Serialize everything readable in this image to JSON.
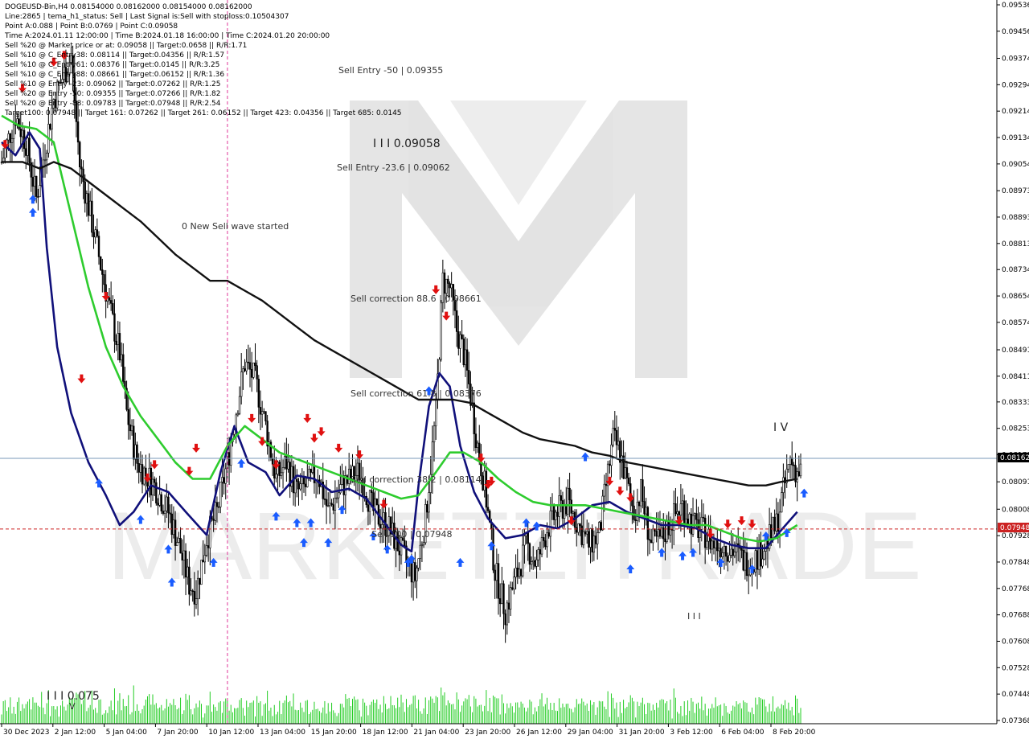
{
  "window": {
    "symbol_line": "DOGEUSD-Bin,H4  0.08154000 0.08162000 0.08154000 0.08162000"
  },
  "info_lines": [
    "Line:2865  | tema_h1_status: Sell | Last Signal is:Sell with stoploss:0.10504307",
    "Point A:0.088 | Point B:0.0769 | Point C:0.09058",
    "Time A:2024.01.11 12:00:00 | Time B:2024.01.18 16:00:00 | Time C:2024.01.20 20:00:00",
    "Sell %20 @ Market price or at: 0.09058 || Target:0.0658 || R/R:1.71",
    "Sell %10 @ C_Entry38: 0.08114 || Target:0.04356 || R/R:1.57",
    "Sell %10 @ C_Entry61: 0.08376 || Target:0.0145 || R/R:3.25",
    "Sell %10 @ C_Entry88: 0.08661 || Target:0.06152 || R/R:1.36",
    "Sell %10 @ Entry -23: 0.09062 || Target:0.07262 || R/R:1.25",
    "Sell %20 @ Entry -50: 0.09355 || Target:0.07266 || R/R:1.82",
    "Sell %20 @ Entry -88: 0.09783 || Target:0.07948 || R/R:2.54",
    "Target100: 0.07948 || Target 161: 0.07262 || Target 261: 0.06152 || Target 423: 0.04356 || Target 685: 0.0145"
  ],
  "annotations": {
    "sell_entry_50": "Sell Entry -50 | 0.09355",
    "point_c": "I I I 0.09058",
    "sell_entry_236": "Sell Entry -23.6 | 0.09062",
    "new_sell_wave": "0 New Sell wave started",
    "sell_corr_886": "Sell correction 88.6 | 0.08661",
    "sell_corr_618": "Sell correction 61.8 | 0.08376",
    "sell_corr_382": "Sell correction 38.2 | 0.08114",
    "sell_100": "Sell 100 | 0.07948",
    "point_b": "I I I 0.075",
    "wave_iv": "I V",
    "wave_iii_small": "I I I",
    "wave_v_low": "V"
  },
  "price_labels": {
    "current": "0.08162",
    "target": "0.07948"
  },
  "colors": {
    "ema_fast": "#10107a",
    "ema_mid": "#2ecc2e",
    "ema_slow": "#111111",
    "up_arrow": "#1a5cff",
    "down_arrow": "#e01010",
    "volume": "#22cc22",
    "current_line": "#7a9ab8",
    "target_line": "#cc2222",
    "time_marker": "#e0389a"
  },
  "chart_data": {
    "type": "candlestick",
    "y_ticks": [
      "0.09536",
      "0.09456",
      "0.09374",
      "0.09294",
      "0.09214",
      "0.09134",
      "0.09054",
      "0.08973",
      "0.08893",
      "0.08813",
      "0.08734",
      "0.08654",
      "0.08574",
      "0.08491",
      "0.08411",
      "0.08333",
      "0.08253",
      "0.08173",
      "0.08091",
      "0.08008",
      "0.07928",
      "0.07848",
      "0.07768",
      "0.07688",
      "0.07608",
      "0.07528",
      "0.07448",
      "0.07368"
    ],
    "ylim": [
      0.07368,
      0.09536
    ],
    "x_ticks": [
      "30 Dec 2023",
      "2 Jan 12:00",
      "5 Jan 04:00",
      "7 Jan 20:00",
      "10 Jan 12:00",
      "13 Jan 04:00",
      "15 Jan 20:00",
      "18 Jan 12:00",
      "21 Jan 04:00",
      "23 Jan 20:00",
      "26 Jan 12:00",
      "29 Jan 04:00",
      "31 Jan 20:00",
      "3 Feb 12:00",
      "6 Feb 04:00",
      "8 Feb 20:00"
    ],
    "price_path": [
      [
        0,
        0.0906
      ],
      [
        8,
        0.092
      ],
      [
        14,
        0.0912
      ],
      [
        20,
        0.0895
      ],
      [
        30,
        0.0925
      ],
      [
        40,
        0.0938
      ],
      [
        45,
        0.0905
      ],
      [
        55,
        0.088
      ],
      [
        62,
        0.0862
      ],
      [
        68,
        0.0848
      ],
      [
        72,
        0.083
      ],
      [
        78,
        0.0815
      ],
      [
        88,
        0.0808
      ],
      [
        96,
        0.08
      ],
      [
        102,
        0.079
      ],
      [
        108,
        0.0778
      ],
      [
        112,
        0.0776
      ],
      [
        118,
        0.0792
      ],
      [
        124,
        0.08
      ],
      [
        130,
        0.0815
      ],
      [
        134,
        0.0828
      ],
      [
        140,
        0.0845
      ],
      [
        146,
        0.084
      ],
      [
        152,
        0.0826
      ],
      [
        158,
        0.081
      ],
      [
        164,
        0.0815
      ],
      [
        170,
        0.0806
      ],
      [
        176,
        0.0808
      ],
      [
        182,
        0.0812
      ],
      [
        188,
        0.08
      ],
      [
        196,
        0.0808
      ],
      [
        206,
        0.0812
      ],
      [
        214,
        0.08
      ],
      [
        222,
        0.0796
      ],
      [
        230,
        0.0788
      ],
      [
        238,
        0.078
      ],
      [
        244,
        0.0798
      ],
      [
        250,
        0.083
      ],
      [
        254,
        0.087
      ],
      [
        258,
        0.0868
      ],
      [
        262,
        0.0855
      ],
      [
        266,
        0.0848
      ],
      [
        270,
        0.0835
      ],
      [
        274,
        0.082
      ],
      [
        278,
        0.0808
      ],
      [
        284,
        0.0782
      ],
      [
        290,
        0.077
      ],
      [
        296,
        0.078
      ],
      [
        302,
        0.079
      ],
      [
        308,
        0.0784
      ],
      [
        314,
        0.0795
      ],
      [
        320,
        0.08
      ],
      [
        326,
        0.0803
      ],
      [
        332,
        0.0796
      ],
      [
        338,
        0.079
      ],
      [
        344,
        0.0793
      ],
      [
        348,
        0.0808
      ],
      [
        352,
        0.0822
      ],
      [
        356,
        0.0818
      ],
      [
        360,
        0.0808
      ],
      [
        364,
        0.08
      ],
      [
        368,
        0.0806
      ],
      [
        374,
        0.079
      ],
      [
        380,
        0.0792
      ],
      [
        386,
        0.0798
      ],
      [
        392,
        0.0802
      ],
      [
        398,
        0.0796
      ],
      [
        404,
        0.0794
      ],
      [
        410,
        0.079
      ],
      [
        416,
        0.079
      ],
      [
        422,
        0.0788
      ],
      [
        428,
        0.0785
      ],
      [
        434,
        0.0786
      ],
      [
        440,
        0.079
      ],
      [
        446,
        0.0796
      ],
      [
        450,
        0.0806
      ],
      [
        454,
        0.0816
      ],
      [
        458,
        0.0812
      ]
    ],
    "series": [
      {
        "name": "",
        "color": "#10107a",
        "values": [
          [
            0,
            0.0912
          ],
          [
            8,
            0.0908
          ],
          [
            16,
            0.0915
          ],
          [
            22,
            0.091
          ],
          [
            26,
            0.088
          ],
          [
            32,
            0.085
          ],
          [
            40,
            0.083
          ],
          [
            50,
            0.0815
          ],
          [
            60,
            0.0805
          ],
          [
            68,
            0.0796
          ],
          [
            76,
            0.08
          ],
          [
            86,
            0.0808
          ],
          [
            96,
            0.0806
          ],
          [
            106,
            0.08
          ],
          [
            118,
            0.0793
          ],
          [
            126,
            0.0812
          ],
          [
            134,
            0.0826
          ],
          [
            142,
            0.0815
          ],
          [
            152,
            0.0812
          ],
          [
            160,
            0.0805
          ],
          [
            170,
            0.0811
          ],
          [
            180,
            0.081
          ],
          [
            190,
            0.0806
          ],
          [
            200,
            0.0807
          ],
          [
            210,
            0.0804
          ],
          [
            220,
            0.0797
          ],
          [
            230,
            0.079
          ],
          [
            236,
            0.0788
          ],
          [
            240,
            0.0808
          ],
          [
            246,
            0.0832
          ],
          [
            252,
            0.0842
          ],
          [
            258,
            0.0838
          ],
          [
            264,
            0.082
          ],
          [
            272,
            0.0806
          ],
          [
            280,
            0.0798
          ],
          [
            290,
            0.0792
          ],
          [
            300,
            0.0793
          ],
          [
            310,
            0.0796
          ],
          [
            320,
            0.0795
          ],
          [
            330,
            0.0798
          ],
          [
            340,
            0.0802
          ],
          [
            350,
            0.0803
          ],
          [
            360,
            0.08
          ],
          [
            370,
            0.0798
          ],
          [
            380,
            0.0796
          ],
          [
            390,
            0.0796
          ],
          [
            400,
            0.0795
          ],
          [
            410,
            0.0792
          ],
          [
            420,
            0.079
          ],
          [
            430,
            0.0789
          ],
          [
            440,
            0.0789
          ],
          [
            448,
            0.0794
          ],
          [
            458,
            0.08
          ]
        ]
      },
      {
        "name": "",
        "color": "#2ecc2e",
        "values": [
          [
            0,
            0.092
          ],
          [
            10,
            0.0917
          ],
          [
            20,
            0.0916
          ],
          [
            30,
            0.0912
          ],
          [
            40,
            0.089
          ],
          [
            50,
            0.0868
          ],
          [
            60,
            0.085
          ],
          [
            70,
            0.0838
          ],
          [
            80,
            0.0829
          ],
          [
            90,
            0.0822
          ],
          [
            100,
            0.0815
          ],
          [
            110,
            0.081
          ],
          [
            120,
            0.081
          ],
          [
            130,
            0.082
          ],
          [
            140,
            0.0826
          ],
          [
            150,
            0.0822
          ],
          [
            160,
            0.0818
          ],
          [
            170,
            0.0816
          ],
          [
            180,
            0.0814
          ],
          [
            190,
            0.0812
          ],
          [
            200,
            0.081
          ],
          [
            210,
            0.0808
          ],
          [
            220,
            0.0806
          ],
          [
            230,
            0.0804
          ],
          [
            240,
            0.0805
          ],
          [
            250,
            0.0812
          ],
          [
            258,
            0.0818
          ],
          [
            266,
            0.0818
          ],
          [
            276,
            0.0815
          ],
          [
            286,
            0.081
          ],
          [
            296,
            0.0806
          ],
          [
            306,
            0.0803
          ],
          [
            316,
            0.0802
          ],
          [
            326,
            0.0802
          ],
          [
            336,
            0.0802
          ],
          [
            346,
            0.0801
          ],
          [
            356,
            0.08
          ],
          [
            366,
            0.0799
          ],
          [
            376,
            0.0798
          ],
          [
            386,
            0.0797
          ],
          [
            396,
            0.0796
          ],
          [
            406,
            0.0796
          ],
          [
            416,
            0.0794
          ],
          [
            426,
            0.0792
          ],
          [
            436,
            0.0791
          ],
          [
            446,
            0.0792
          ],
          [
            458,
            0.0796
          ]
        ]
      },
      {
        "name": "",
        "color": "#111111",
        "values": [
          [
            0,
            0.0906
          ],
          [
            12,
            0.0906
          ],
          [
            22,
            0.0904
          ],
          [
            30,
            0.0906
          ],
          [
            40,
            0.0904
          ],
          [
            50,
            0.09
          ],
          [
            60,
            0.0896
          ],
          [
            70,
            0.0892
          ],
          [
            80,
            0.0888
          ],
          [
            90,
            0.0883
          ],
          [
            100,
            0.0878
          ],
          [
            110,
            0.0874
          ],
          [
            120,
            0.087
          ],
          [
            130,
            0.087
          ],
          [
            140,
            0.0867
          ],
          [
            150,
            0.0864
          ],
          [
            160,
            0.086
          ],
          [
            170,
            0.0856
          ],
          [
            180,
            0.0852
          ],
          [
            190,
            0.0849
          ],
          [
            200,
            0.0846
          ],
          [
            210,
            0.0843
          ],
          [
            220,
            0.084
          ],
          [
            230,
            0.0837
          ],
          [
            240,
            0.0834
          ],
          [
            250,
            0.0834
          ],
          [
            260,
            0.0834
          ],
          [
            270,
            0.0833
          ],
          [
            280,
            0.083
          ],
          [
            290,
            0.0827
          ],
          [
            300,
            0.0824
          ],
          [
            310,
            0.0822
          ],
          [
            320,
            0.0821
          ],
          [
            330,
            0.082
          ],
          [
            340,
            0.0818
          ],
          [
            350,
            0.0817
          ],
          [
            360,
            0.0815
          ],
          [
            370,
            0.0814
          ],
          [
            380,
            0.0813
          ],
          [
            390,
            0.0812
          ],
          [
            400,
            0.0811
          ],
          [
            410,
            0.081
          ],
          [
            420,
            0.0809
          ],
          [
            430,
            0.0808
          ],
          [
            440,
            0.0808
          ],
          [
            448,
            0.0809
          ],
          [
            458,
            0.081
          ]
        ]
      }
    ],
    "x_index_max": 460,
    "current_price": 0.08162,
    "target_level": 0.07948,
    "time_marker_index": 130,
    "up_arrows": [
      [
        18,
        0.0898
      ],
      [
        18,
        0.0894
      ],
      [
        56,
        0.0812
      ],
      [
        80,
        0.0801
      ],
      [
        96,
        0.0792
      ],
      [
        98,
        0.0782
      ],
      [
        122,
        0.0788
      ],
      [
        138,
        0.0818
      ],
      [
        158,
        0.0802
      ],
      [
        170,
        0.08
      ],
      [
        174,
        0.0794
      ],
      [
        178,
        0.08
      ],
      [
        188,
        0.0794
      ],
      [
        196,
        0.0804
      ],
      [
        214,
        0.0796
      ],
      [
        222,
        0.0792
      ],
      [
        234,
        0.0788
      ],
      [
        236,
        0.0789
      ],
      [
        246,
        0.084
      ],
      [
        264,
        0.0788
      ],
      [
        282,
        0.0793
      ],
      [
        302,
        0.08
      ],
      [
        308,
        0.0799
      ],
      [
        336,
        0.082
      ],
      [
        362,
        0.0786
      ],
      [
        380,
        0.0791
      ],
      [
        392,
        0.079
      ],
      [
        398,
        0.0791
      ],
      [
        414,
        0.0788
      ],
      [
        432,
        0.0786
      ],
      [
        440,
        0.0796
      ],
      [
        452,
        0.0797
      ],
      [
        462,
        0.0809
      ]
    ],
    "down_arrows": [
      [
        2,
        0.0908
      ],
      [
        12,
        0.0925
      ],
      [
        30,
        0.0933
      ],
      [
        36,
        0.0935
      ],
      [
        60,
        0.0862
      ],
      [
        46,
        0.0837
      ],
      [
        84,
        0.0807
      ],
      [
        88,
        0.0811
      ],
      [
        108,
        0.0809
      ],
      [
        112,
        0.0816
      ],
      [
        144,
        0.0825
      ],
      [
        150,
        0.0818
      ],
      [
        158,
        0.0811
      ],
      [
        176,
        0.0825
      ],
      [
        180,
        0.0819
      ],
      [
        184,
        0.0821
      ],
      [
        194,
        0.0816
      ],
      [
        206,
        0.0814
      ],
      [
        220,
        0.0799
      ],
      [
        250,
        0.0864
      ],
      [
        256,
        0.0856
      ],
      [
        276,
        0.0813
      ],
      [
        280,
        0.0805
      ],
      [
        282,
        0.0806
      ],
      [
        328,
        0.0794
      ],
      [
        350,
        0.0806
      ],
      [
        356,
        0.0803
      ],
      [
        362,
        0.0801
      ],
      [
        390,
        0.0794
      ],
      [
        408,
        0.079
      ],
      [
        418,
        0.0793
      ],
      [
        426,
        0.0794
      ],
      [
        432,
        0.0793
      ]
    ]
  }
}
